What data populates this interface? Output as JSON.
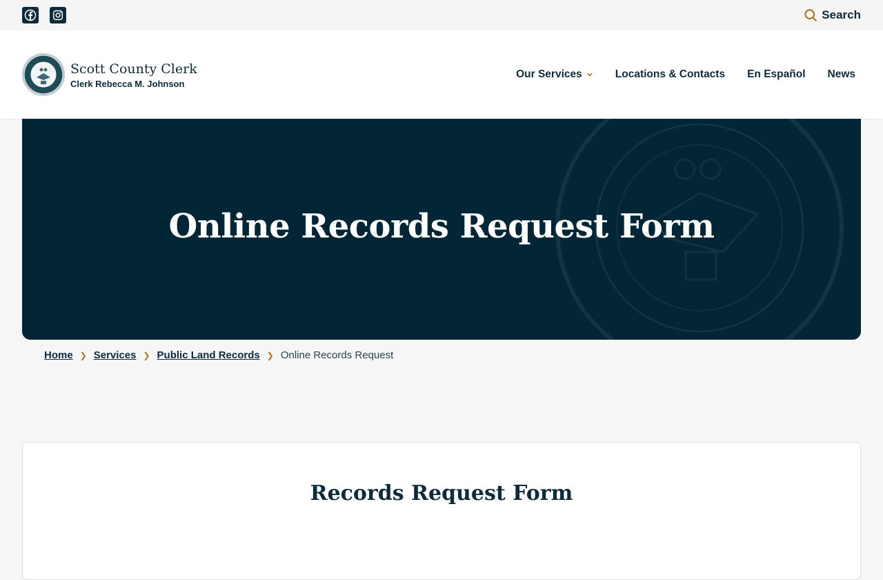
{
  "topbar": {
    "social": [
      {
        "name": "facebook-icon"
      },
      {
        "name": "instagram-icon"
      }
    ],
    "search_label": "Search"
  },
  "brand": {
    "name": "Scott County Clerk",
    "subtitle": "Clerk Rebecca M. Johnson"
  },
  "nav": {
    "items": [
      {
        "label": "Our Services",
        "has_dropdown": true
      },
      {
        "label": "Locations & Contacts"
      },
      {
        "label": "En Español"
      },
      {
        "label": "News"
      }
    ]
  },
  "hero": {
    "title": "Online Records Request Form"
  },
  "breadcrumb": {
    "items": [
      "Home",
      "Services",
      "Public Land Records"
    ],
    "current": "Online Records Request"
  },
  "card": {
    "title": "Records Request Form"
  },
  "colors": {
    "primary": "#0d2b3a",
    "hero_bg": "#032636",
    "accent": "#a97a1c",
    "page_bg": "#f6f6f6"
  }
}
